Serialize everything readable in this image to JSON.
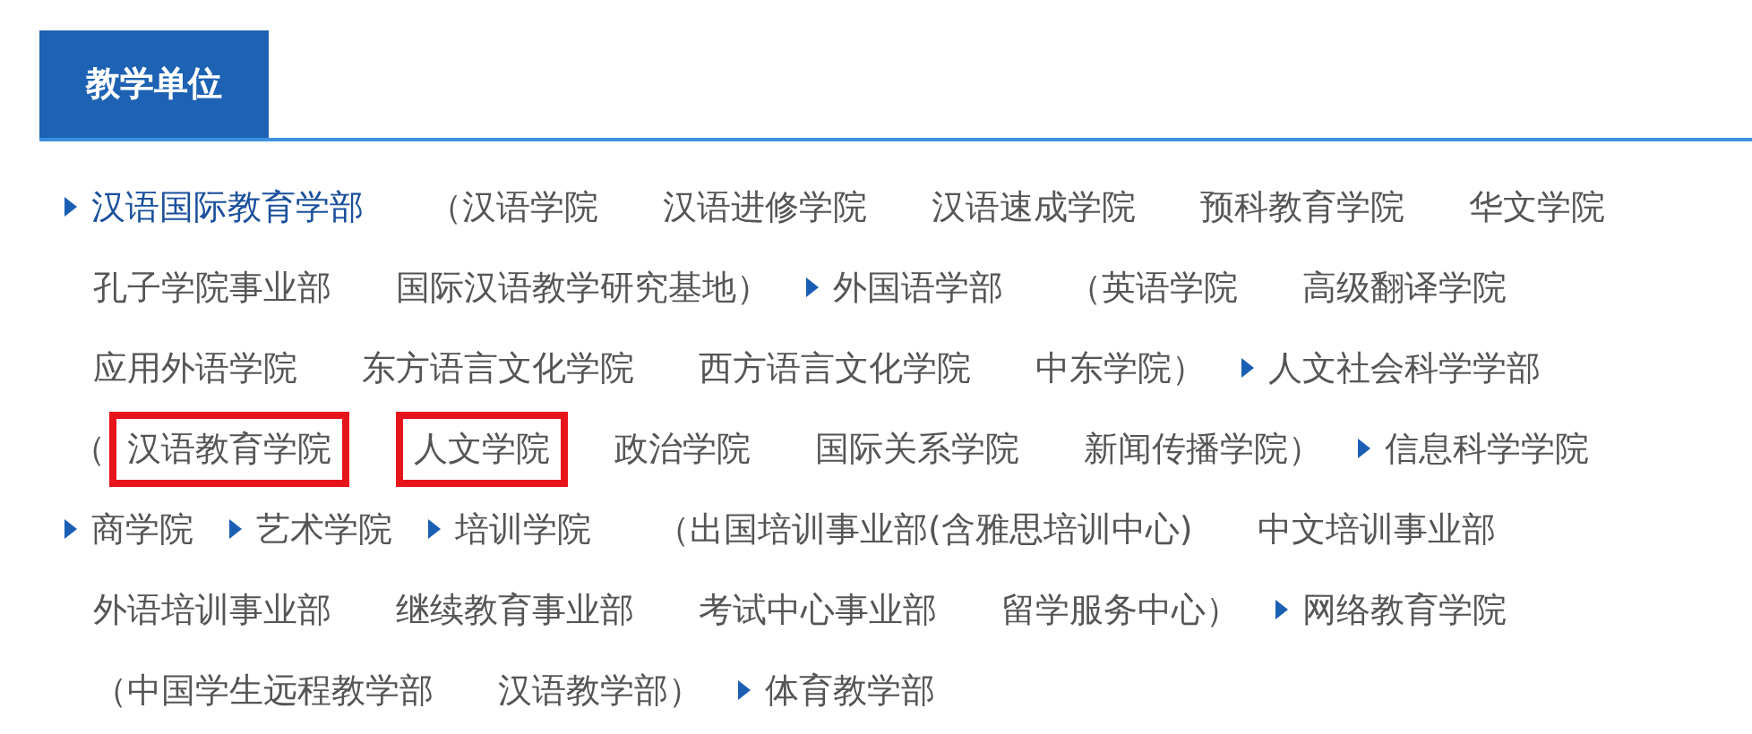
{
  "tabs": [
    {
      "label": "教学单位",
      "selected": true
    }
  ],
  "lines": [
    {
      "items": [
        {
          "kind": "department",
          "text": "汉语国际教育学部",
          "selected": true
        },
        {
          "kind": "college",
          "text": "（汉语学院"
        },
        {
          "kind": "college",
          "text": "汉语进修学院"
        },
        {
          "kind": "college",
          "text": "汉语速成学院"
        },
        {
          "kind": "college",
          "text": "预科教育学院"
        },
        {
          "kind": "college",
          "text": "华文学院"
        }
      ]
    },
    {
      "items": [
        {
          "kind": "college",
          "text": "孔子学院事业部"
        },
        {
          "kind": "college",
          "text": "国际汉语教学研究基地）"
        },
        {
          "kind": "department",
          "text": "外国语学部",
          "selected": false
        },
        {
          "kind": "college",
          "text": "（英语学院"
        },
        {
          "kind": "college",
          "text": "高级翻译学院"
        }
      ]
    },
    {
      "items": [
        {
          "kind": "college",
          "text": "应用外语学院"
        },
        {
          "kind": "college",
          "text": "东方语言文化学院"
        },
        {
          "kind": "college",
          "text": "西方语言文化学院"
        },
        {
          "kind": "college",
          "text": "中东学院）"
        },
        {
          "kind": "department",
          "text": "人文社会科学学部",
          "selected": false
        }
      ]
    },
    {
      "items": [
        {
          "kind": "paren",
          "text": "（"
        },
        {
          "kind": "college",
          "text": "汉语教育学院",
          "highlighted": true
        },
        {
          "kind": "college",
          "text": "人文学院",
          "highlighted": true
        },
        {
          "kind": "college",
          "text": "政治学院",
          "highlighted": false
        },
        {
          "kind": "college",
          "text": "国际关系学院",
          "highlighted": false
        },
        {
          "kind": "college",
          "text": "新闻传播学院）",
          "highlighted": false
        },
        {
          "kind": "department",
          "text": "信息科学学院",
          "selected": false
        }
      ]
    },
    {
      "items": [
        {
          "kind": "department",
          "text": "商学院",
          "selected": false
        },
        {
          "kind": "department",
          "text": "艺术学院",
          "selected": false
        },
        {
          "kind": "department",
          "text": "培训学院",
          "selected": false
        },
        {
          "kind": "college",
          "text": "（出国培训事业部(含雅思培训中心)"
        },
        {
          "kind": "college",
          "text": "中文培训事业部"
        }
      ]
    },
    {
      "items": [
        {
          "kind": "college",
          "text": "外语培训事业部"
        },
        {
          "kind": "college",
          "text": "继续教育事业部"
        },
        {
          "kind": "college",
          "text": "考试中心事业部"
        },
        {
          "kind": "college",
          "text": "留学服务中心）"
        },
        {
          "kind": "department",
          "text": "网络教育学院",
          "selected": false
        }
      ]
    },
    {
      "items": [
        {
          "kind": "college",
          "text": "（中国学生远程教学部"
        },
        {
          "kind": "college",
          "text": "汉语教学部）"
        },
        {
          "kind": "department",
          "text": "体育教学部",
          "selected": false
        }
      ]
    }
  ]
}
